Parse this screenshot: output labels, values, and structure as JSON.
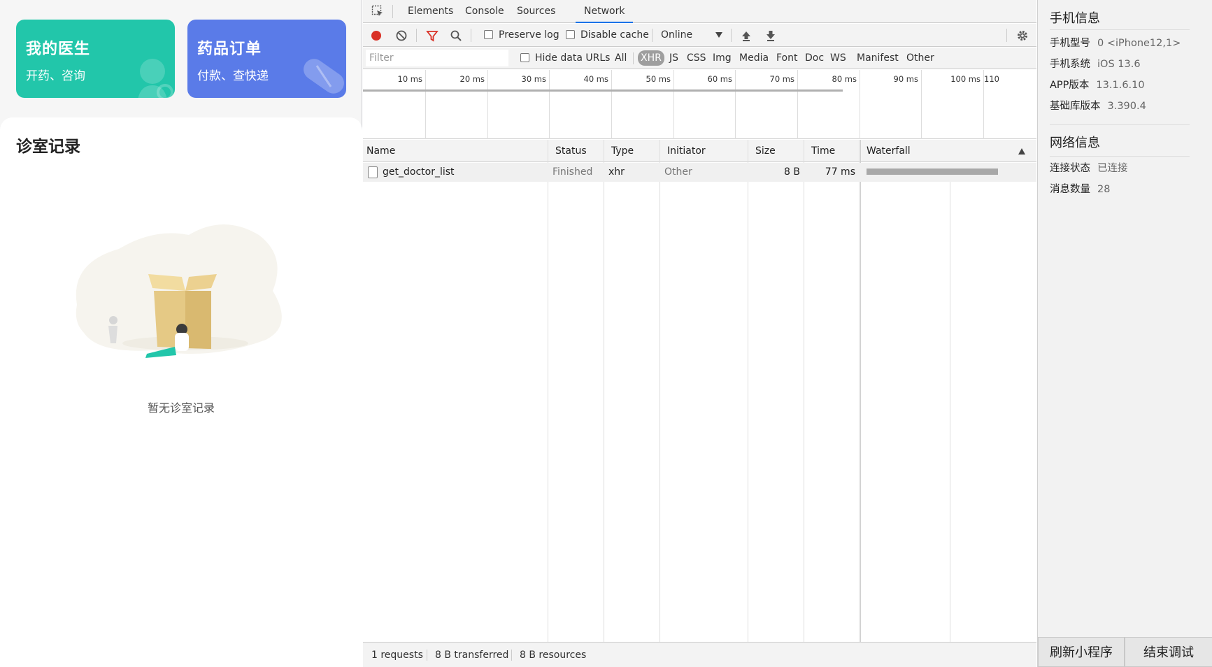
{
  "app": {
    "cards": [
      {
        "title": "我的医生",
        "subtitle": "开药、咨询",
        "color": "#22c6aa"
      },
      {
        "title": "药品订单",
        "subtitle": "付款、查快递",
        "color": "#5a7be8"
      }
    ],
    "section_title": "诊室记录",
    "empty_text": "暂无诊室记录"
  },
  "devtools": {
    "tabs": [
      "Elements",
      "Console",
      "Sources",
      "Network"
    ],
    "active_tab": "Network",
    "toolbar": {
      "preserve_log": "Preserve log",
      "disable_cache": "Disable cache",
      "throttle": "Online"
    },
    "filter": {
      "placeholder": "Filter",
      "hide_data_urls": "Hide data URLs",
      "types": [
        "All",
        "XHR",
        "JS",
        "CSS",
        "Img",
        "Media",
        "Font",
        "Doc",
        "WS",
        "Manifest",
        "Other"
      ],
      "selected_type": "XHR"
    },
    "overview_ticks": [
      "10 ms",
      "20 ms",
      "30 ms",
      "40 ms",
      "50 ms",
      "60 ms",
      "70 ms",
      "80 ms",
      "90 ms",
      "100 ms",
      "110"
    ],
    "columns": [
      "Name",
      "Status",
      "Type",
      "Initiator",
      "Size",
      "Time",
      "Waterfall"
    ],
    "rows": [
      {
        "name": "get_doctor_list",
        "status": "Finished",
        "type": "xhr",
        "initiator": "Other",
        "size": "8 B",
        "time": "77 ms"
      }
    ],
    "summary": {
      "requests": "1 requests",
      "transferred": "8 B transferred",
      "resources": "8 B resources"
    }
  },
  "info": {
    "phone_title": "手机信息",
    "phone": [
      {
        "key": "手机型号",
        "value": "0 <iPhone12,1>"
      },
      {
        "key": "手机系统",
        "value": "iOS 13.6"
      },
      {
        "key": "APP版本",
        "value": "13.1.6.10"
      },
      {
        "key": "基础库版本",
        "value": "3.390.4"
      }
    ],
    "network_title": "网络信息",
    "network": [
      {
        "key": "连接状态",
        "value": "已连接"
      },
      {
        "key": "消息数量",
        "value": "28"
      }
    ],
    "buttons": {
      "refresh": "刷新小程序",
      "end": "结束调试"
    }
  }
}
